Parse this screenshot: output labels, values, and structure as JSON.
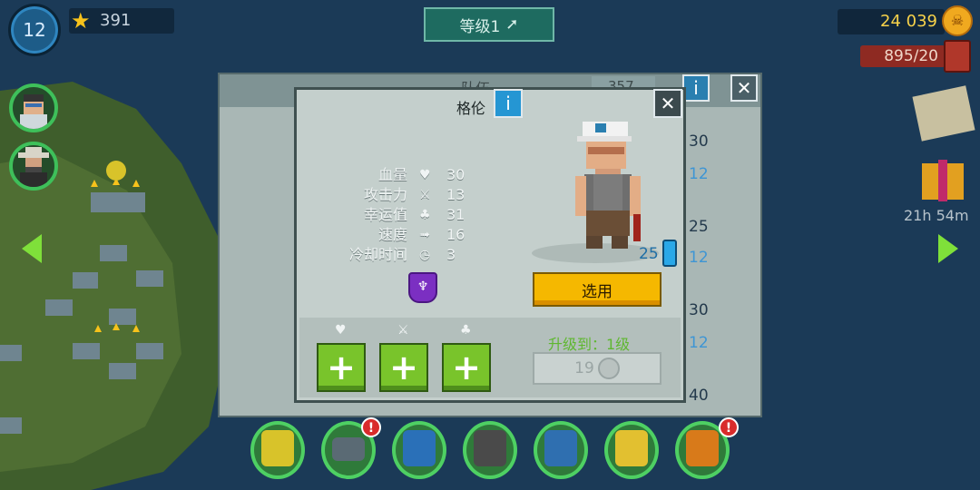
{
  "hud": {
    "player_level": "12",
    "stars": "391",
    "level_button": "等级1",
    "coins": "24 039",
    "fuel": "895/20"
  },
  "side": {
    "timer": "21h 54m"
  },
  "team_panel": {
    "title": "队伍",
    "count": "357",
    "row_numbers": [
      "30",
      "12",
      "25",
      "12",
      "30",
      "12",
      "40"
    ]
  },
  "character": {
    "name": "格伦",
    "level_badge": "25",
    "stats": [
      {
        "label": "血量",
        "icon": "heart-icon",
        "glyph": "♥",
        "value": "30"
      },
      {
        "label": "攻击力",
        "icon": "sword-icon",
        "glyph": "⚔",
        "value": "13"
      },
      {
        "label": "幸运值",
        "icon": "clover-icon",
        "glyph": "♣",
        "value": "31"
      },
      {
        "label": "速度",
        "icon": "boot-icon",
        "glyph": "➟",
        "value": "16"
      },
      {
        "label": "冷却时间",
        "icon": "stopwatch-icon",
        "glyph": "◷",
        "value": "3"
      }
    ],
    "use_button": "选用",
    "upgrade_to": "升级到：1级",
    "upgrade_cost": "19"
  },
  "colors": {
    "accent_green": "#79c42b",
    "use_yellow": "#f5b800",
    "info_blue": "#2596d3"
  }
}
